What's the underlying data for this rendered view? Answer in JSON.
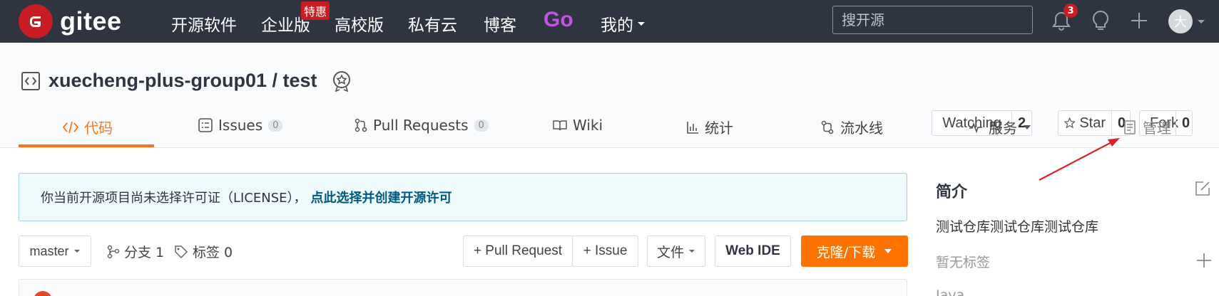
{
  "nav": {
    "logo_text": "gitee",
    "items": [
      "开源软件",
      "企业版",
      "高校版",
      "私有云",
      "博客"
    ],
    "special_badge": "特惠",
    "go_label": "Go",
    "mine_label": "我的",
    "search_placeholder": "搜开源",
    "notification_count": "3",
    "avatar_initial": "大"
  },
  "repo": {
    "title": "xuecheng-plus-group01 / test",
    "watching": {
      "label": "Watching",
      "count": "2"
    },
    "star": {
      "label": "Star",
      "count": "0"
    },
    "fork": {
      "label": "Fork",
      "count": "0"
    }
  },
  "tabs": {
    "code": "代码",
    "issues": "Issues",
    "issues_count": "0",
    "prs": "Pull Requests",
    "prs_count": "0",
    "wiki": "Wiki",
    "stats": "统计",
    "pipeline": "流水线",
    "services": "服务",
    "manage": "管理"
  },
  "notice": {
    "text": "你当前开源项目尚未选择许可证（LICENSE），",
    "link": "点此选择并创建开源许可"
  },
  "toolbar": {
    "branch": "master",
    "branches": "分支 1",
    "tags": "标签 0",
    "pull_request": "+ Pull Request",
    "issue": "+ Issue",
    "files": "文件",
    "web_ide": "Web IDE",
    "clone": "克隆/下载"
  },
  "sidebar": {
    "title": "简介",
    "description": "测试仓库测试仓库测试仓库",
    "no_tags": "暂无标签",
    "language": "Java"
  },
  "colors": {
    "nav_bg": "#2e3440",
    "brand_red": "#c71d23",
    "accent_orange": "#fe7300",
    "go_purple": "#c552e6"
  }
}
